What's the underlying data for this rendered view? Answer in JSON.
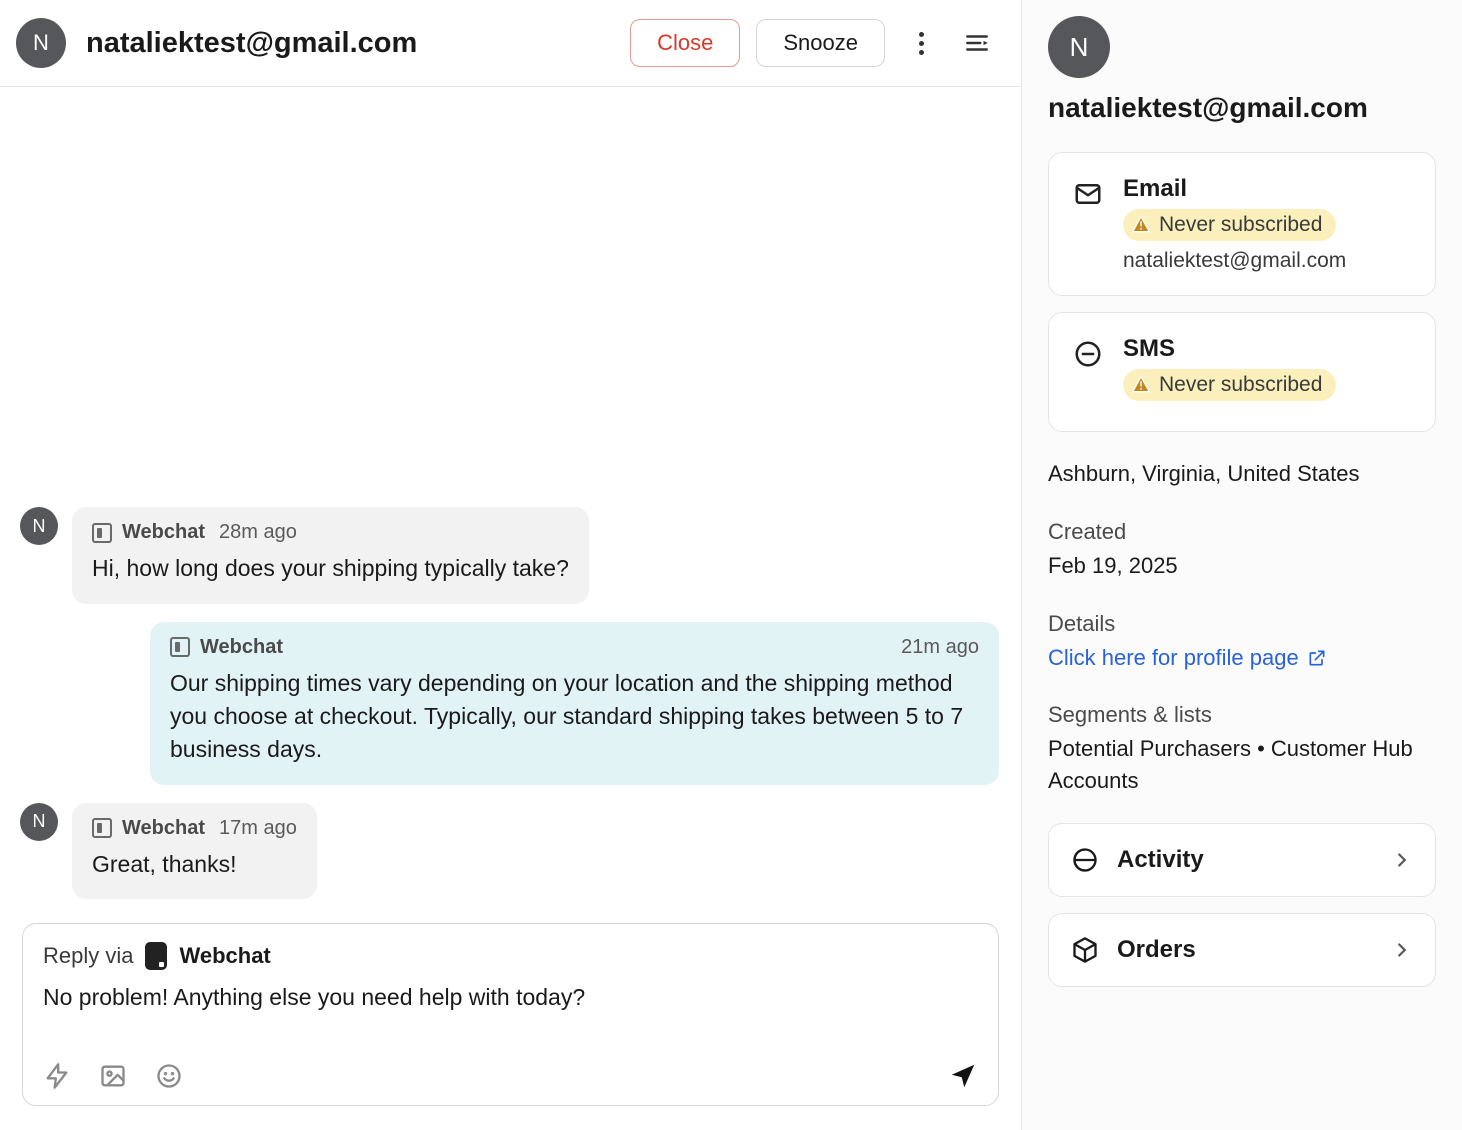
{
  "header": {
    "avatar_initial": "N",
    "title": "nataliektest@gmail.com",
    "close_label": "Close",
    "snooze_label": "Snooze"
  },
  "messages": [
    {
      "dir": "in",
      "avatar": "N",
      "channel": "Webchat",
      "ts": "28m ago",
      "body": "Hi, how long does your shipping typically take?"
    },
    {
      "dir": "out",
      "channel": "Webchat",
      "ts": "21m ago",
      "body": "Our shipping times vary depending on your location and the shipping method you choose at checkout. Typically, our standard shipping takes between 5 to 7 business days."
    },
    {
      "dir": "in",
      "avatar": "N",
      "channel": "Webchat",
      "ts": "17m ago",
      "body": "Great, thanks!"
    }
  ],
  "reply": {
    "prefix": "Reply via",
    "channel": "Webchat",
    "draft": "No problem! Anything else you need help with today?"
  },
  "sidebar": {
    "avatar_initial": "N",
    "name": "nataliektest@gmail.com",
    "email_card": {
      "title": "Email",
      "status": "Never subscribed",
      "value": "nataliektest@gmail.com"
    },
    "sms_card": {
      "title": "SMS",
      "status": "Never subscribed"
    },
    "location": "Ashburn, Virginia, United States",
    "created_label": "Created",
    "created_value": "Feb 19, 2025",
    "details_label": "Details",
    "details_link": "Click here for profile page",
    "segments_label": "Segments & lists",
    "segments_value": "Potential Purchasers • Customer Hub Accounts",
    "nav": {
      "activity": "Activity",
      "orders": "Orders"
    }
  }
}
